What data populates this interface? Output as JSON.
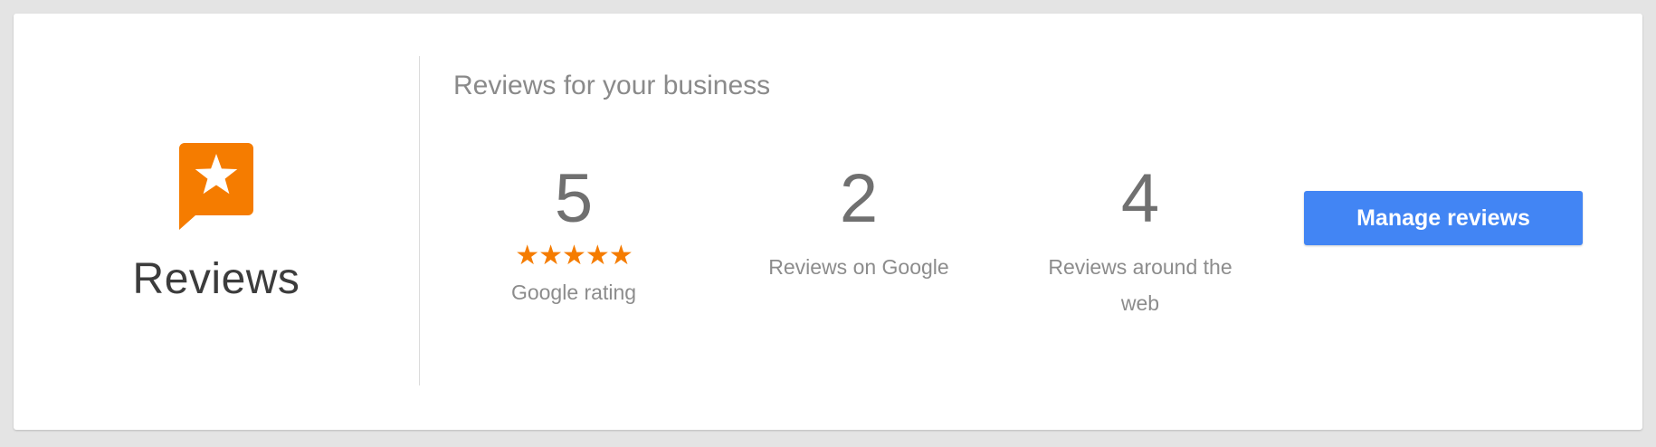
{
  "panel": {
    "icon": "reviews-star-bubble-icon",
    "title": "Reviews"
  },
  "main": {
    "heading": "Reviews for your business",
    "stats": [
      {
        "value": "5",
        "stars": "★★★★★",
        "rating_out_of_5": 5,
        "label": "Google rating"
      },
      {
        "value": "2",
        "label": "Reviews on Google"
      },
      {
        "value": "4",
        "label": "Reviews around the web"
      }
    ],
    "manage_button": "Manage reviews"
  },
  "colors": {
    "accent_orange": "#f57c00",
    "button_blue": "#4285f4",
    "background": "#e4e4e4",
    "card": "#ffffff"
  }
}
